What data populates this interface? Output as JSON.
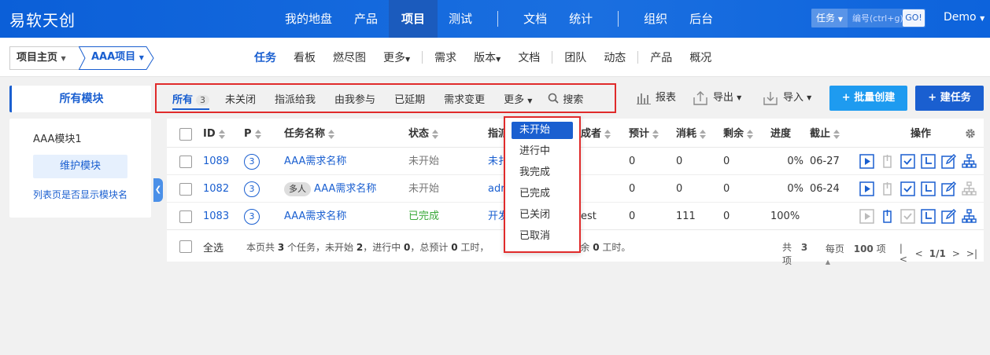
{
  "header": {
    "logo": "易软天创",
    "nav": [
      "我的地盘",
      "产品",
      "项目",
      "测试",
      "文档",
      "统计",
      "组织",
      "后台"
    ],
    "search_type": "任务",
    "search_placeholder": "编号(ctrl+g)",
    "go_label": "GO!",
    "user": "Demo"
  },
  "subnav": {
    "crumb_home": "项目主页",
    "crumb_project": "AAA项目",
    "tabs": [
      "任务",
      "看板",
      "燃尽图",
      "更多",
      "需求",
      "版本",
      "文档",
      "团队",
      "动态",
      "产品",
      "概况"
    ]
  },
  "modules": {
    "title": "所有模块",
    "module1": "AAA模块1",
    "maintain": "维护模块",
    "show_name": "列表页是否显示模块名"
  },
  "filters": {
    "all": "所有",
    "all_count": "3",
    "items": [
      "未关闭",
      "指派给我",
      "由我参与",
      "已延期",
      "需求变更"
    ],
    "more": "更多",
    "search": "搜索"
  },
  "toolbar": {
    "report": "报表",
    "export": "导出",
    "import": "导入",
    "batch_create": "+ 批量创建",
    "create": "+ 建任务"
  },
  "table": {
    "headers": {
      "id": "ID",
      "p": "P",
      "name": "任务名称",
      "status": "状态",
      "assign": "指派",
      "finisher": "成者",
      "estimate": "预计",
      "consumed": "消耗",
      "left": "剩余",
      "progress": "进度",
      "deadline": "截止",
      "actions": "操作"
    },
    "rows": [
      {
        "id": "1089",
        "p": "3",
        "tag": "",
        "name": "AAA需求名称",
        "status": "未开始",
        "assign": "未扌",
        "finisher": "",
        "estimate": "0",
        "consumed": "0",
        "left": "0",
        "progress": "0%",
        "deadline": "06-27"
      },
      {
        "id": "1082",
        "p": "3",
        "tag": "多人",
        "name": "AAA需求名称",
        "status": "未开始",
        "assign": "adr",
        "finisher": "",
        "estimate": "0",
        "consumed": "0",
        "left": "0",
        "progress": "0%",
        "deadline": "06-24"
      },
      {
        "id": "1083",
        "p": "3",
        "tag": "",
        "name": "AAA需求名称",
        "status": "已完成",
        "assign": "开发",
        "finisher": "est",
        "estimate": "0",
        "consumed": "111",
        "left": "0",
        "progress": "100%",
        "deadline": ""
      }
    ],
    "select_all": "全选",
    "summary_parts": [
      "本页共 ",
      "3",
      " 个任务，未开始 ",
      "2",
      "，进行中 ",
      "0",
      "，总预计 ",
      "0",
      " 工时，",
      "剩余 ",
      "0",
      " 工时。"
    ],
    "pager": {
      "total_prefix": "共 ",
      "total": "3",
      "total_suffix": " 项",
      "per_prefix": "每页 ",
      "per": "100",
      "per_suffix": " 项",
      "page": "1/1"
    }
  },
  "dropdown": {
    "options": [
      "未开始",
      "进行中",
      "我完成",
      "已完成",
      "已关闭",
      "已取消"
    ]
  },
  "colors": {
    "brand": "#1a5fd0",
    "header": "#0b5fd8",
    "highlight_border": "#e02b2b",
    "done": "#3aa93a"
  }
}
